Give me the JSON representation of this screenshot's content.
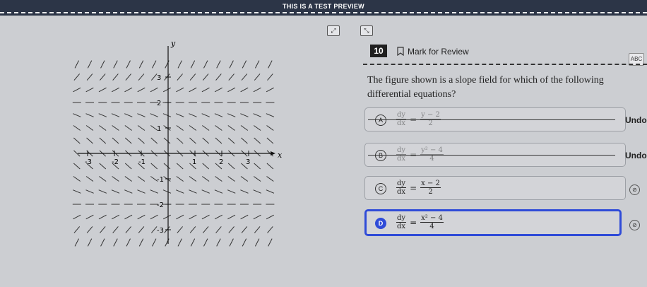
{
  "header": {
    "preview_title": "THIS IS A TEST PREVIEW"
  },
  "toolbar": {
    "icons": [
      "expand-icon",
      "collapse-icon"
    ]
  },
  "graph": {
    "y_label": "y",
    "x_label": "x",
    "x_ticks": [
      "-3",
      "-2",
      "-1",
      "1",
      "2",
      "3"
    ],
    "y_ticks": [
      "3",
      "2",
      "1",
      "-1",
      "-2",
      "-3"
    ]
  },
  "question": {
    "number": "10",
    "mark_label": "Mark for Review",
    "abc_label": "ABC",
    "text": "The figure shown is a slope field for which of the following differential equations?",
    "options": [
      {
        "letter": "A",
        "lhs_num": "dy",
        "lhs_den": "dx",
        "eq": "=",
        "rhs_num": "y − 2",
        "rhs_den": "2",
        "state": "crossed",
        "action": "Undo"
      },
      {
        "letter": "B",
        "lhs_num": "dy",
        "lhs_den": "dx",
        "eq": "=",
        "rhs_num": "y² − 4",
        "rhs_den": "4",
        "state": "crossed",
        "action": "Undo"
      },
      {
        "letter": "C",
        "lhs_num": "dy",
        "lhs_den": "dx",
        "eq": "=",
        "rhs_num": "x − 2",
        "rhs_den": "2",
        "state": "normal"
      },
      {
        "letter": "D",
        "lhs_num": "dy",
        "lhs_den": "dx",
        "eq": "=",
        "rhs_num": "x² − 4",
        "rhs_den": "4",
        "state": "selected"
      }
    ]
  },
  "colors": {
    "accent": "#2f4bd8",
    "topbar": "#2c3547",
    "background": "#ccced2"
  }
}
